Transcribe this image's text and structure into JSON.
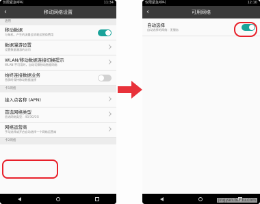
{
  "left_phone": {
    "status": {
      "carrier": "仅限紧急呼叫",
      "time": "11:34"
    },
    "title": "移动网络设置",
    "sections": [
      {
        "header": "通用",
        "rows": [
          {
            "title": "移动数据",
            "subtitle": "与每机，产生的流量会消耗运营商费用",
            "control": "toggle-on"
          },
          {
            "title": "数据漫游设置",
            "subtitle": "设置数据漫游的访问",
            "control": "chevron"
          },
          {
            "title": "WLAN/移动数据连接切换提示",
            "subtitle": "WLAN 不可用时，自动切换移动数据网络",
            "control": "chevron"
          },
          {
            "title": "始终连接数据业务",
            "subtitle": "息屏时保持移动数据连接",
            "control": "toggle-off"
          }
        ]
      },
      {
        "header": "卡1网络",
        "rows": [
          {
            "title": "接入点名称 (APN)",
            "subtitle": "",
            "control": "chevron"
          },
          {
            "title": "首选网络类型",
            "subtitle": "首选网络类型：4G/3G/2G",
            "control": "chevron"
          },
          {
            "title": "网络运营商",
            "subtitle": "手动选择或开启自动选择一个网络运营商",
            "control": "chevron"
          }
        ]
      },
      {
        "header": "卡2网络",
        "rows": []
      }
    ]
  },
  "right_phone": {
    "status": {
      "carrier": "仅限紧急呼叫",
      "time": "12:10"
    },
    "title": "可用网络",
    "rows": [
      {
        "title": "自动选择",
        "subtitle": "自动选择的网络：无服务",
        "control": "toggle-on"
      }
    ]
  },
  "watermark": "jingyan.baidu.com",
  "colors": {
    "toggle_on": "#19a39a",
    "highlight": "#e8202a",
    "arrow": "#e8323a",
    "titlebar": "#3a3a3a"
  }
}
